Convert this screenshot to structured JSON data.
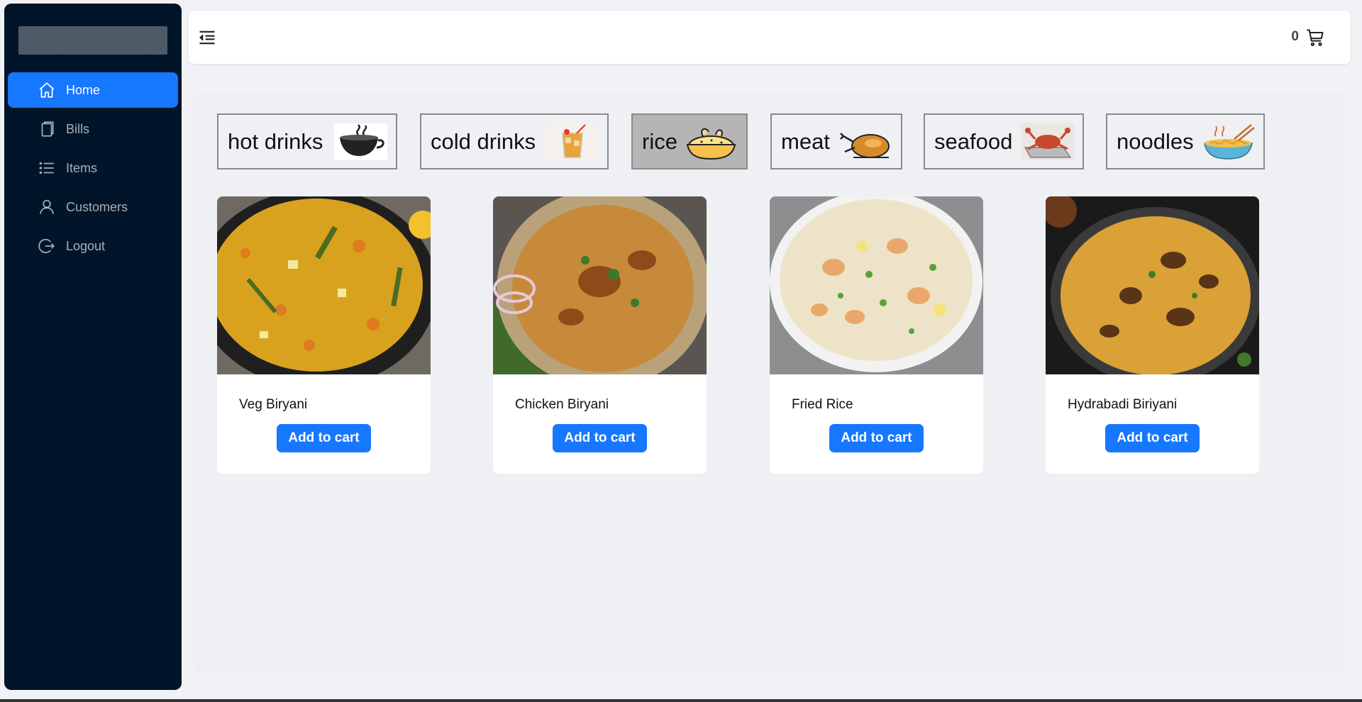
{
  "sidebar": {
    "items": [
      {
        "label": "Home",
        "icon": "home-icon",
        "active": true
      },
      {
        "label": "Bills",
        "icon": "copy-icon",
        "active": false
      },
      {
        "label": "Items",
        "icon": "list-icon",
        "active": false
      },
      {
        "label": "Customers",
        "icon": "user-icon",
        "active": false
      },
      {
        "label": "Logout",
        "icon": "logout-icon",
        "active": false
      }
    ]
  },
  "header": {
    "cart_count": "0",
    "toggle_icon": "menu-fold-icon",
    "cart_icon": "shopping-cart-icon"
  },
  "categories": [
    {
      "label": "hot drinks",
      "icon": "coffee-cup-icon",
      "selected": false
    },
    {
      "label": "cold drinks",
      "icon": "iced-drink-icon",
      "selected": false
    },
    {
      "label": "rice",
      "icon": "rice-dish-icon",
      "selected": true
    },
    {
      "label": "meat",
      "icon": "roast-chicken-icon",
      "selected": false
    },
    {
      "label": "seafood",
      "icon": "crab-icon",
      "selected": false
    },
    {
      "label": "noodles",
      "icon": "noodle-bowl-icon",
      "selected": false
    }
  ],
  "items": [
    {
      "name": "Veg Biryani",
      "button": "Add to cart"
    },
    {
      "name": "Chicken Biryani",
      "button": "Add to cart"
    },
    {
      "name": "Fried Rice",
      "button": "Add to cart"
    },
    {
      "name": "Hydrabadi Biriyani",
      "button": "Add to cart"
    }
  ],
  "colors": {
    "sidebar_bg": "#001529",
    "accent": "#1677ff",
    "content_bg": "#eef0f4",
    "selected_category": "#b5b5b5"
  }
}
